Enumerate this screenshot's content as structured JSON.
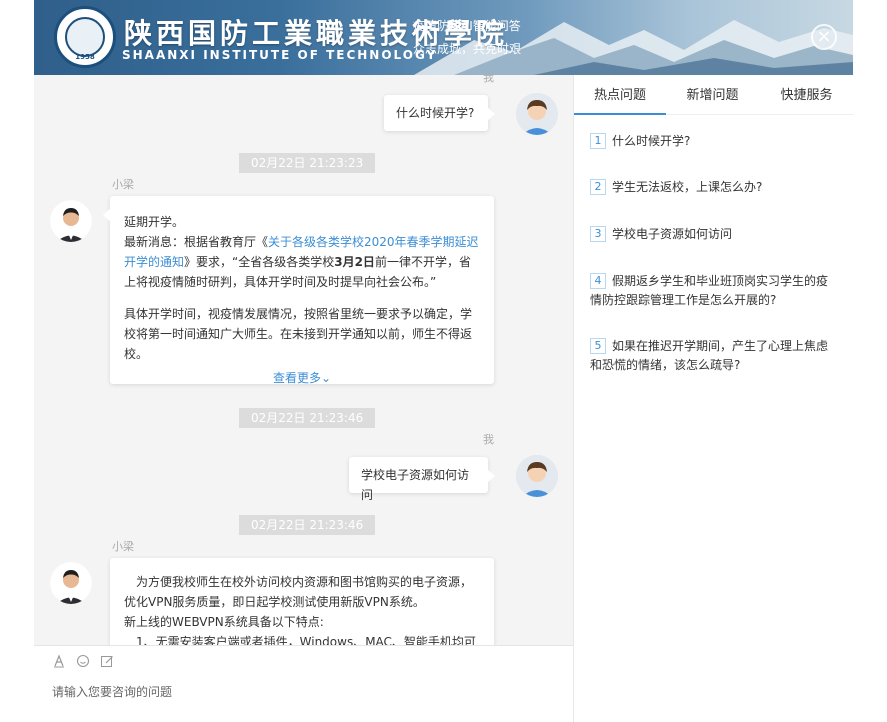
{
  "header": {
    "school_name_cn": "陕西国防工業職業技術學院",
    "school_name_en": "SHAANXI INSTITUTE OF TECHNOLOGY",
    "logo_year": "1958",
    "tagline_1": "疫情防控AI智能问答",
    "tagline_2": "众志成城，共克时艰",
    "close_icon": "close-icon"
  },
  "chat": {
    "me_label": "我",
    "bot_label": "小梁",
    "messages": [
      {
        "from": "user",
        "text": "什么时候开学?"
      },
      {
        "timestamp": "02月22日 21:23:23"
      },
      {
        "from": "bot",
        "line1": "延期开学。",
        "line2_prefix": "最新消息：根据省教育厅《",
        "line2_link": "关于各级各类学校2020年春季学期延迟开学的通知",
        "line2_mid": "》要求，“全省各级各类学校",
        "line2_bold": "3月2日",
        "line2_suffix": "前一律不开学，省上将视疫情随时研判，具体开学时间及时提早向社会公布。”",
        "para2": "具体开学时间，视疫情发展情况，按照省里统一要求予以确定，学校将第一时间通知广大师生。在未接到开学通知以前，师生不得返校。",
        "more": "查看更多⌄"
      },
      {
        "timestamp": "02月22日 21:23:46"
      },
      {
        "from": "user",
        "text": "学校电子资源如何访问"
      },
      {
        "timestamp": "02月22日 21:23:46"
      },
      {
        "from": "bot",
        "line1": "为方便我校师生在校外访问校内资源和图书馆购买的电子资源，优化VPN服务质量，即日起学校测试使用新版VPN系统。",
        "line2": "新上线的WEBVPN系统具备以下特点:",
        "line3": "1、无需安装客户端或者插件，Windows、MAC、智能手机均可"
      }
    ]
  },
  "input": {
    "placeholder": "请输入您要咨询的问题",
    "tools": [
      "font-icon",
      "emoji-icon",
      "edit-icon"
    ]
  },
  "panel": {
    "tabs": [
      "热点问题",
      "新增问题",
      "快捷服务"
    ],
    "active_tab": 0,
    "questions": [
      {
        "num": "1",
        "text": "什么时候开学?"
      },
      {
        "num": "2",
        "text": "学生无法返校，上课怎么办?"
      },
      {
        "num": "3",
        "text": "学校电子资源如何访问"
      },
      {
        "num": "4",
        "text": "假期返乡学生和毕业班顶岗实习学生的疫情防控跟踪管理工作是怎么开展的?"
      },
      {
        "num": "5",
        "text": "如果在推迟开学期间，产生了心理上焦虑和恐慌的情绪，该怎么疏导?"
      }
    ]
  },
  "colors": {
    "accent": "#3b8ed6",
    "timestamp_bg": "#dcdcdc",
    "chat_bg": "#f4f4f4"
  }
}
